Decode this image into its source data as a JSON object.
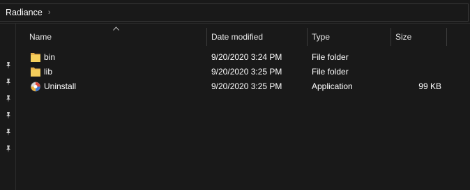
{
  "address": {
    "breadcrumb": "Radiance",
    "separator": "›"
  },
  "columns": {
    "name": "Name",
    "date_modified": "Date modified",
    "type": "Type",
    "size": "Size"
  },
  "files": [
    {
      "name": "bin",
      "date_modified": "9/20/2020 3:24 PM",
      "type": "File folder",
      "size": "",
      "icon": "folder-icon"
    },
    {
      "name": "lib",
      "date_modified": "9/20/2020 3:25 PM",
      "type": "File folder",
      "size": "",
      "icon": "folder-icon"
    },
    {
      "name": "Uninstall",
      "date_modified": "9/20/2020 3:25 PM",
      "type": "Application",
      "size": "99 KB",
      "icon": "application-icon"
    }
  ],
  "colors": {
    "background": "#191919",
    "folder": "#f2c14e",
    "text": "#ffffff"
  }
}
